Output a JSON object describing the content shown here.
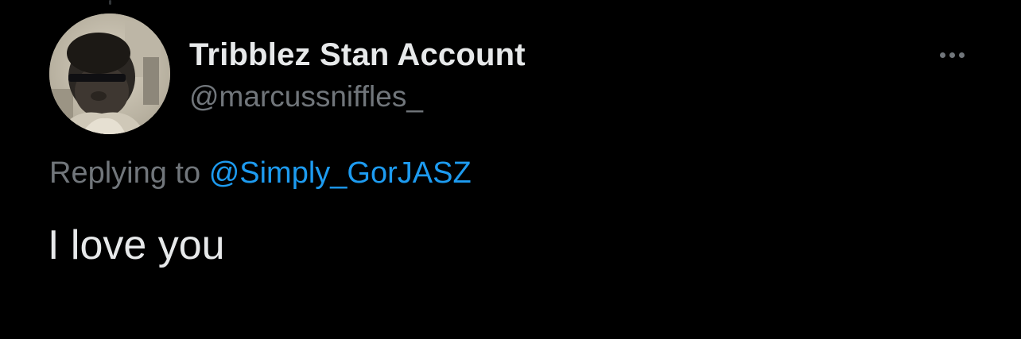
{
  "tweet": {
    "author": {
      "display_name": "Tribblez Stan Account",
      "handle": "@marcussniffles_",
      "avatar_icon": "profile-photo"
    },
    "more_icon": "more-horizontal-icon",
    "reply_context": {
      "prefix": "Replying to",
      "mention": "@Simply_GorJASZ"
    },
    "text": "I love you"
  },
  "colors": {
    "background": "#000000",
    "primary_text": "#e7e9ea",
    "secondary_text": "#71767b",
    "link": "#1d9bf0"
  }
}
